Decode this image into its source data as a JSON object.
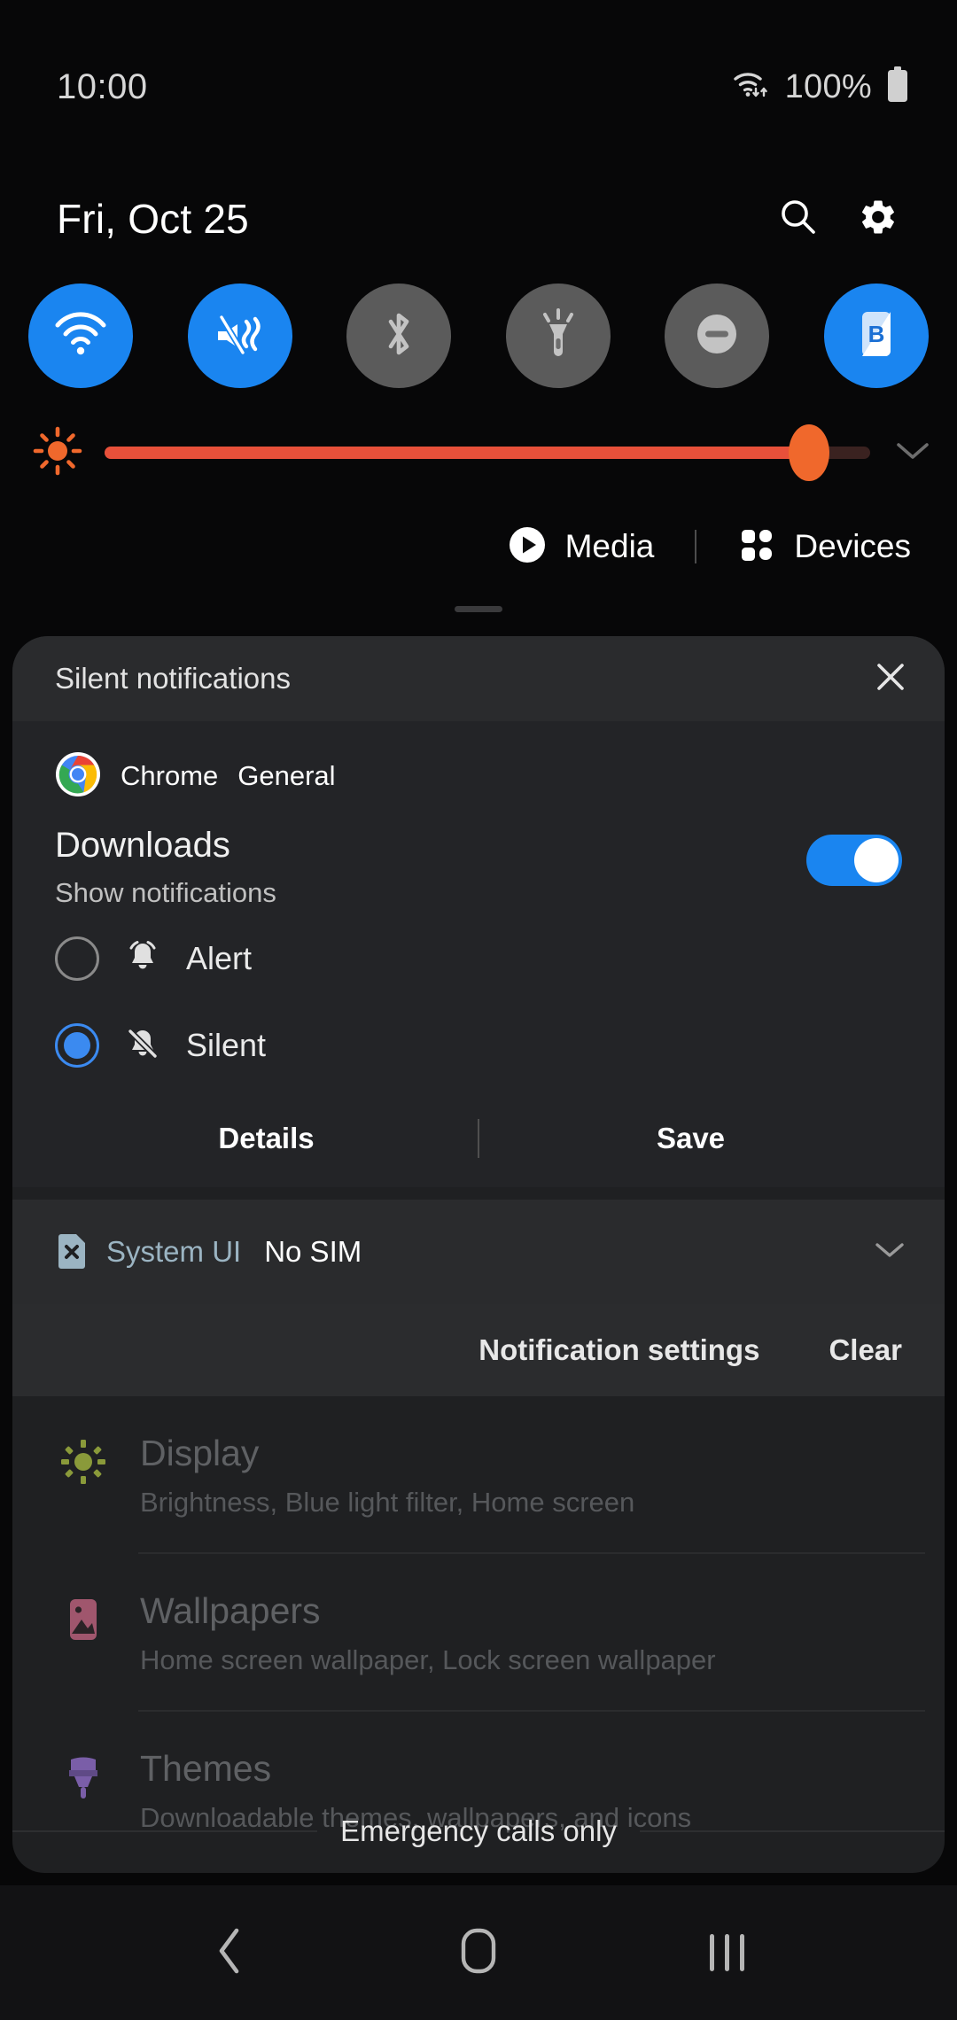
{
  "status_bar": {
    "clock": "10:00",
    "battery_percent": "100%",
    "wifi_icon": "wifi-activity-icon",
    "battery_icon": "battery-full-icon"
  },
  "quick_panel": {
    "date": "Fri, Oct 25",
    "search_icon": "search-icon",
    "settings_icon": "gear-icon",
    "toggles": [
      {
        "name": "wifi",
        "icon": "wifi-icon",
        "state": "on"
      },
      {
        "name": "sound-mode",
        "icon": "vibrate-mute-icon",
        "state": "on"
      },
      {
        "name": "bluetooth",
        "icon": "bluetooth-icon",
        "state": "off"
      },
      {
        "name": "flashlight",
        "icon": "flashlight-icon",
        "state": "off"
      },
      {
        "name": "do-not-disturb",
        "icon": "dnd-icon",
        "state": "off"
      },
      {
        "name": "blue-light-filter",
        "icon": "blue-light-b-icon",
        "state": "on"
      }
    ],
    "brightness": {
      "icon": "brightness-icon",
      "value_percent": 92,
      "expand_icon": "chevron-down-icon",
      "track_color": "#e8503a",
      "knob_color": "#f0682c"
    },
    "media_label": "Media",
    "media_icon": "play-circle-icon",
    "devices_label": "Devices",
    "devices_icon": "devices-grid-icon"
  },
  "shade": {
    "header_title": "Silent notifications",
    "close_icon": "close-icon",
    "notification": {
      "app_icon": "chrome-icon",
      "app_name": "Chrome",
      "channel_group": "General",
      "channel_title": "Downloads",
      "channel_subtitle": "Show notifications",
      "toggle_state": "on",
      "toggle_color": "#1a85f0",
      "options": [
        {
          "label": "Alert",
          "icon": "bell-icon",
          "selected": false
        },
        {
          "label": "Silent",
          "icon": "bell-slash-icon",
          "selected": true
        }
      ],
      "details_label": "Details",
      "save_label": "Save"
    },
    "system_notification": {
      "app_icon": "sim-card-x-icon",
      "app_name": "System UI",
      "text": "No SIM",
      "expand_icon": "chevron-down-icon"
    },
    "footer": {
      "notification_settings_label": "Notification settings",
      "clear_label": "Clear"
    }
  },
  "settings_background": {
    "items": [
      {
        "title": "Display",
        "subtitle": "Brightness, Blue light filter, Home screen",
        "icon": "display-sun-icon",
        "icon_color": "#8a9a3a"
      },
      {
        "title": "Wallpapers",
        "subtitle": "Home screen wallpaper, Lock screen wallpaper",
        "icon": "wallpaper-image-icon",
        "icon_color": "#a0566d"
      },
      {
        "title": "Themes",
        "subtitle": "Downloadable themes, wallpapers, and icons",
        "icon": "themes-brush-icon",
        "icon_color": "#7a5ea8"
      }
    ],
    "emergency_text": "Emergency calls only"
  },
  "nav_bar": {
    "back_icon": "back-chevron-icon",
    "home_icon": "home-icon",
    "recents_icon": "recents-icon"
  }
}
